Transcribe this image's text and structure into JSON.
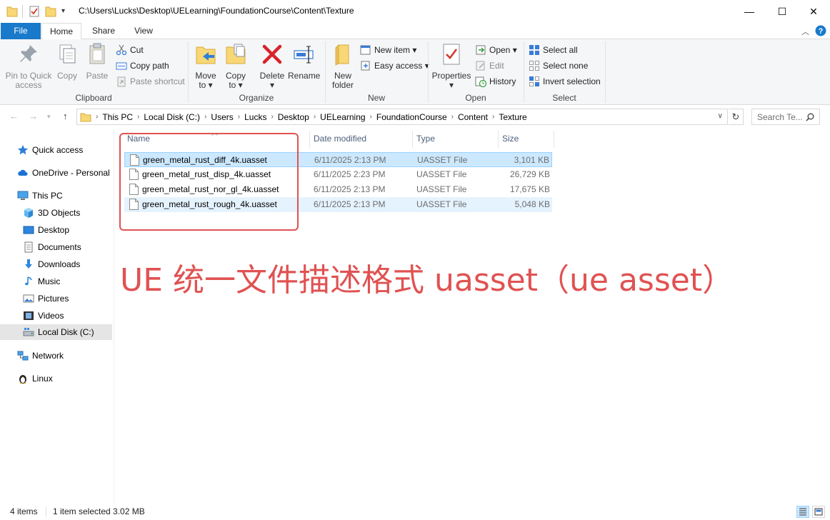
{
  "window": {
    "title_path": "C:\\Users\\Lucks\\Desktop\\UELearning\\FoundationCourse\\Content\\Texture",
    "minimize": "—",
    "maximize": "☐",
    "close": "✕"
  },
  "ribbon_tabs": [
    "File",
    "Home",
    "Share",
    "View"
  ],
  "ribbon": {
    "clipboard": {
      "label": "Clipboard",
      "pin_line1": "Pin to Quick",
      "pin_line2": "access",
      "copy": "Copy",
      "paste": "Paste",
      "cut": "Cut",
      "copy_path": "Copy path",
      "paste_shortcut": "Paste shortcut"
    },
    "organize": {
      "label": "Organize",
      "move_to_line1": "Move",
      "move_to_line2": "to ▾",
      "copy_to_line1": "Copy",
      "copy_to_line2": "to ▾",
      "delete_line1": "Delete",
      "delete_line2": "▾",
      "rename": "Rename"
    },
    "new": {
      "label": "New",
      "new_folder_line1": "New",
      "new_folder_line2": "folder",
      "new_item": "New item ▾",
      "easy_access": "Easy access ▾"
    },
    "open": {
      "label": "Open",
      "properties_line1": "Properties",
      "properties_line2": "▾",
      "open": "Open ▾",
      "edit": "Edit",
      "history": "History"
    },
    "select": {
      "label": "Select",
      "select_all": "Select all",
      "select_none": "Select none",
      "invert_selection": "Invert selection"
    }
  },
  "address": {
    "breadcrumbs": [
      "This PC",
      "Local Disk (C:)",
      "Users",
      "Lucks",
      "Desktop",
      "UELearning",
      "FoundationCourse",
      "Content",
      "Texture"
    ],
    "search_placeholder": "Search Te..."
  },
  "nav_pane": {
    "quick_access": "Quick access",
    "onedrive": "OneDrive - Personal",
    "this_pc": "This PC",
    "objects_3d": "3D Objects",
    "desktop": "Desktop",
    "documents": "Documents",
    "downloads": "Downloads",
    "music": "Music",
    "pictures": "Pictures",
    "videos": "Videos",
    "local_disk": "Local Disk (C:)",
    "network": "Network",
    "linux": "Linux"
  },
  "columns": {
    "name": "Name",
    "date_modified": "Date modified",
    "type": "Type",
    "size": "Size"
  },
  "files": [
    {
      "name": "green_metal_rust_diff_4k.uasset",
      "date": "6/11/2025 2:13 PM",
      "type": "UASSET File",
      "size": "3,101 KB"
    },
    {
      "name": "green_metal_rust_disp_4k.uasset",
      "date": "6/11/2025 2:23 PM",
      "type": "UASSET File",
      "size": "26,729 KB"
    },
    {
      "name": "green_metal_rust_nor_gl_4k.uasset",
      "date": "6/11/2025 2:13 PM",
      "type": "UASSET File",
      "size": "17,675 KB"
    },
    {
      "name": "green_metal_rust_rough_4k.uasset",
      "date": "6/11/2025 2:13 PM",
      "type": "UASSET File",
      "size": "5,048 KB"
    }
  ],
  "annotation": {
    "caption": "UE 统一文件描述格式 uasset（ue asset）",
    "color": "#e05252"
  },
  "status": {
    "item_count": "4 items",
    "selection": "1 item selected  3.02 MB"
  },
  "colors": {
    "accent": "#1979ca",
    "selection": "#cce8ff",
    "hover": "#e5f3ff"
  }
}
